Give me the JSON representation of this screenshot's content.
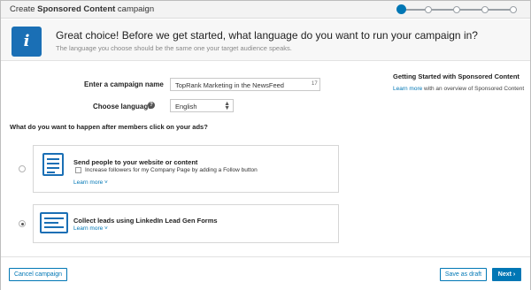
{
  "header": {
    "title_prefix": "Create ",
    "title_bold": "Sponsored Content",
    "title_suffix": " campaign",
    "steps_total": 5,
    "steps_current": 1
  },
  "banner": {
    "icon": "info-icon",
    "heading": "Great choice! Before we get started, what language do you want to run your campaign in?",
    "subtext": "The language you choose should be the same one your target audience speaks."
  },
  "form": {
    "campaign_name_label": "Enter a campaign name",
    "campaign_name_value": "TopRank Marketing in the NewsFeed",
    "campaign_name_counter": "17",
    "language_label": "Choose language",
    "language_value": "English",
    "language_help_icon": "?"
  },
  "sidebar": {
    "title": "Getting Started with Sponsored Content",
    "link": "Learn more",
    "text": " with an overview of Sponsored Content"
  },
  "question": "What do you want to happen after members click on your ads?",
  "options": [
    {
      "title": "Send people to your website or content",
      "checkbox_label": "Increase followers for my Company Page by adding a Follow button",
      "learn_more": "Learn more ˅",
      "selected": false
    },
    {
      "title": "Collect leads using LinkedIn Lead Gen Forms",
      "learn_more": "Learn more ˅",
      "selected": true
    }
  ],
  "footer": {
    "cancel_label": "Cancel campaign",
    "draft_label": "Save as draft",
    "next_label": "Next ›"
  },
  "colors": {
    "accent": "#0077b5",
    "icon_blue": "#1a6fb5"
  }
}
